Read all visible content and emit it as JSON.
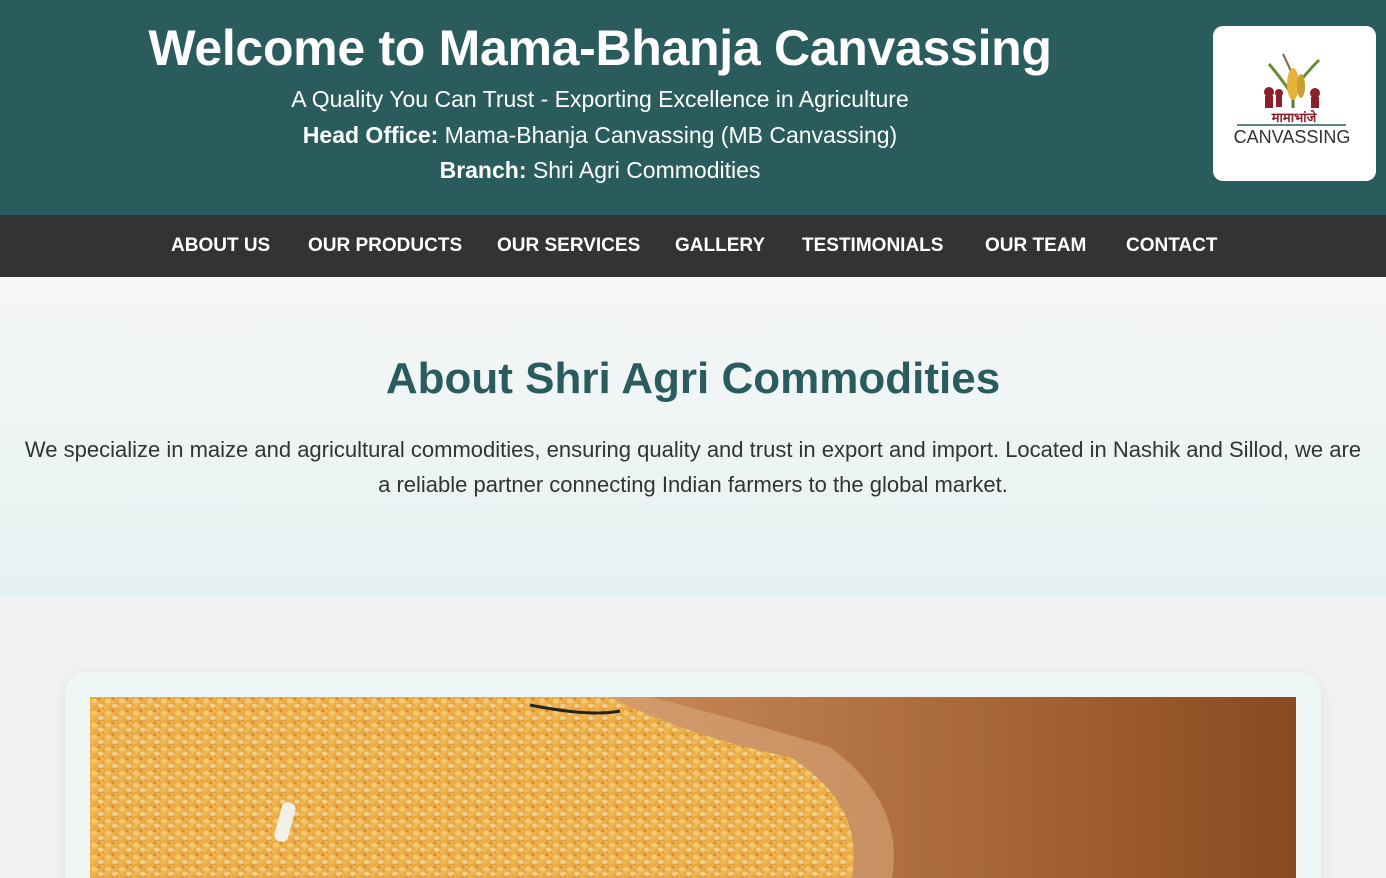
{
  "header": {
    "title": "Welcome to Mama-Bhanja Canvassing",
    "tagline": "A Quality You Can Trust - Exporting Excellence in Agriculture",
    "head_office_label": "Head Office:",
    "head_office_value": " Mama-Bhanja Canvassing (MB Canvassing)",
    "branch_label": "Branch:",
    "branch_value": " Shri Agri Commodities",
    "background_color": "#2a5c5e"
  },
  "logo": {
    "script_text": "मामाभांजे",
    "brand_text": "CANVASSING"
  },
  "nav": {
    "items": [
      "ABOUT US",
      "OUR PRODUCTS",
      "OUR SERVICES",
      "GALLERY",
      "TESTIMONIALS",
      "OUR TEAM",
      "CONTACT"
    ],
    "background_color": "#333333"
  },
  "about": {
    "title": "About Shri Agri Commodities",
    "text": "We specialize in maize and agricultural commodities, ensuring quality and trust in export and import. Located in Nashik and Sillod, we are a reliable partner connecting Indian farmers to the global market.",
    "title_color": "#2a5c5e"
  },
  "gallery": {
    "image_subject": "maize-grains-with-hand-photo"
  }
}
